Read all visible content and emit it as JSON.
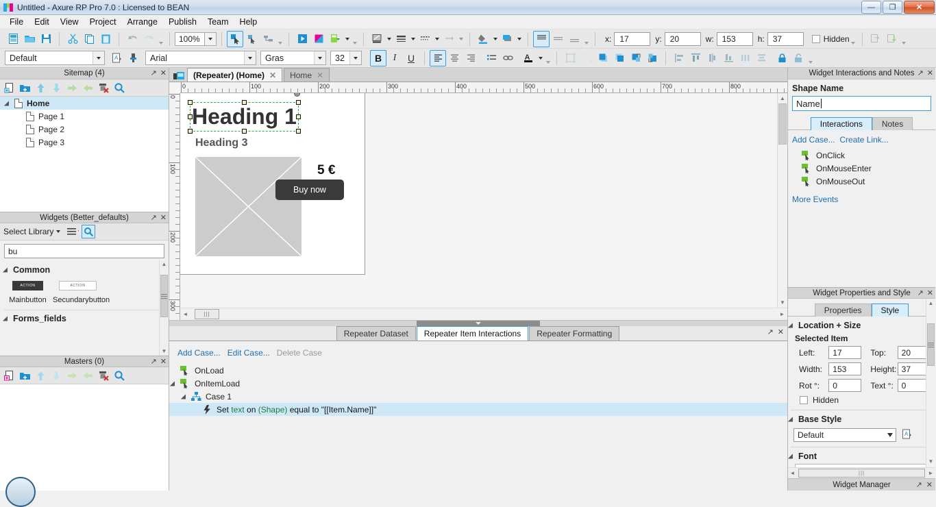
{
  "window": {
    "title": "Untitled - Axure RP Pro 7.0 : Licensed to BEAN",
    "minimize": "—",
    "maximize": "❐",
    "close": "✕"
  },
  "menu": {
    "items": [
      "File",
      "Edit",
      "View",
      "Project",
      "Arrange",
      "Publish",
      "Team",
      "Help"
    ]
  },
  "toolbar": {
    "zoom_value": "100%",
    "style_combo": "Default",
    "font_family": "Arial",
    "font_weight": "Gras",
    "font_size": "32",
    "bold": "B",
    "italic": "I",
    "underline": "U",
    "x_label": "x:",
    "x_value": "17",
    "y_label": "y:",
    "y_value": "20",
    "w_label": "w:",
    "w_value": "153",
    "h_label": "h:",
    "h_value": "37",
    "hidden_label": "Hidden"
  },
  "sitemap": {
    "title": "Sitemap (4)",
    "pages": [
      {
        "label": "Home",
        "level": 0,
        "selected": true
      },
      {
        "label": "Page 1",
        "level": 1,
        "selected": false
      },
      {
        "label": "Page 2",
        "level": 1,
        "selected": false
      },
      {
        "label": "Page 3",
        "level": 1,
        "selected": false
      }
    ]
  },
  "widgets": {
    "title": "Widgets (Better_defaults)",
    "select_library": "Select Library",
    "search_value": "bu",
    "sections": [
      {
        "label": "Common"
      },
      {
        "label": "Forms_fields"
      }
    ],
    "items": [
      {
        "label": "Mainbutton",
        "glyph": "ACTION"
      },
      {
        "label": "Secundarybutton",
        "glyph": "ACTION"
      }
    ]
  },
  "masters": {
    "title": "Masters (0)"
  },
  "canvas": {
    "tabs": [
      {
        "label": "(Repeater) (Home)",
        "active": true,
        "close": "✕"
      },
      {
        "label": "Home",
        "active": false,
        "close": "✕"
      }
    ],
    "h_ruler_labels": [
      "0",
      "100",
      "200",
      "300",
      "400",
      "500",
      "600",
      "700",
      "800"
    ],
    "v_ruler_labels": [
      "0",
      "100",
      "200",
      "300"
    ],
    "page_content": {
      "heading1": "Heading 1",
      "heading3": "Heading 3",
      "price": "5 €",
      "buy_button": "Buy now"
    }
  },
  "repeater": {
    "tabs": [
      {
        "label": "Repeater Dataset",
        "active": false
      },
      {
        "label": "Repeater Item Interactions",
        "active": true
      },
      {
        "label": "Repeater Formatting",
        "active": false
      }
    ],
    "actions": {
      "add_case": "Add Case...",
      "edit_case": "Edit Case...",
      "delete_case": "Delete Case"
    },
    "events": [
      {
        "label": "OnLoad",
        "indent": 1,
        "expander": false,
        "icon": "event-icon",
        "selected": false
      },
      {
        "label": "OnItemLoad",
        "indent": 1,
        "expander": true,
        "icon": "event-icon",
        "selected": false
      },
      {
        "label": "Case 1",
        "indent": 2,
        "expander": true,
        "icon": "case-icon",
        "selected": false
      },
      {
        "label": "Set text on (Shape) equal to \"[[Item.Name]]\"",
        "indent": 3,
        "expander": false,
        "icon": "action-icon",
        "selected": true,
        "parts": [
          {
            "t": "Set ",
            "c": "#111"
          },
          {
            "t": "text",
            "c": "#1f7a3d"
          },
          {
            "t": " on ",
            "c": "#111"
          },
          {
            "t": "(Shape)",
            "c": "#1f7a3d"
          },
          {
            "t": " equal to \"[[Item.Name]]\"",
            "c": "#111"
          }
        ]
      }
    ]
  },
  "interactions_panel": {
    "title": "Widget Interactions and Notes",
    "shape_name_label": "Shape Name",
    "shape_name_value": "Name",
    "tabs": [
      {
        "label": "Interactions",
        "active": true
      },
      {
        "label": "Notes",
        "active": false
      }
    ],
    "links": {
      "add_case": "Add Case...",
      "create_link": "Create Link..."
    },
    "events": [
      "OnClick",
      "OnMouseEnter",
      "OnMouseOut"
    ],
    "more_events": "More Events"
  },
  "properties_panel": {
    "title": "Widget Properties and Style",
    "tabs": [
      {
        "label": "Properties",
        "active": false
      },
      {
        "label": "Style",
        "active": true
      }
    ],
    "location_size": {
      "group_label": "Location + Size",
      "selected_item_label": "Selected Item",
      "fields": [
        {
          "label": "Left:",
          "value": "17"
        },
        {
          "label": "Top:",
          "value": "20"
        },
        {
          "label": "Width:",
          "value": "153"
        },
        {
          "label": "Height:",
          "value": "37"
        },
        {
          "label": "Rot °:",
          "value": "0"
        },
        {
          "label": "Text °:",
          "value": "0"
        }
      ],
      "hidden_label": "Hidden"
    },
    "base_style": {
      "group_label": "Base Style",
      "value": "Default"
    },
    "font": {
      "group_label": "Font"
    }
  },
  "widget_manager": {
    "title": "Widget Manager"
  },
  "panel_controls": {
    "popout": "↗",
    "close": "✕"
  },
  "colors": {
    "accent": "#3c9ad6",
    "link": "#1a6fb5",
    "selection_green": "#22b14c",
    "selection_row": "#cfe8f7",
    "button_dark": "#3a3a3a",
    "title_magenta": "#ec008c",
    "title_cyan": "#29a8e0",
    "title_green": "#8fd44b"
  }
}
